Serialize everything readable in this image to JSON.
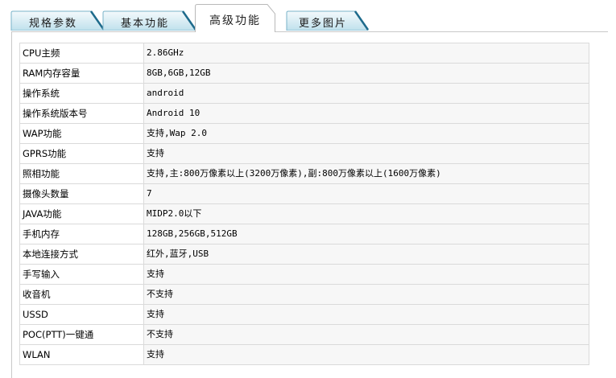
{
  "tabs": [
    {
      "label": "规格参数",
      "active": false
    },
    {
      "label": "基本功能",
      "active": false
    },
    {
      "label": "高级功能",
      "active": true
    },
    {
      "label": "更多图片",
      "active": false
    }
  ],
  "colors": {
    "tab_fill_top": "#f4fafc",
    "tab_fill_bottom": "#bfe0ec",
    "tab_border": "#7ab3c9",
    "tab_edge_dark": "#1e6b8c",
    "active_fill": "#ffffff",
    "active_border": "#b9b9b9",
    "table_border": "#dadada",
    "value_bg": "#f7f7f7"
  },
  "specs": [
    {
      "label": "CPU主频",
      "value": "2.86GHz"
    },
    {
      "label": "RAM内存容量",
      "value": "8GB,6GB,12GB"
    },
    {
      "label": "操作系统",
      "value": "android"
    },
    {
      "label": "操作系统版本号",
      "value": "Android 10"
    },
    {
      "label": "WAP功能",
      "value": "支持,Wap 2.0"
    },
    {
      "label": "GPRS功能",
      "value": "支持"
    },
    {
      "label": "照相功能",
      "value": "支持,主:800万像素以上(3200万像素),副:800万像素以上(1600万像素)"
    },
    {
      "label": "摄像头数量",
      "value": "7"
    },
    {
      "label": "JAVA功能",
      "value": "MIDP2.0以下"
    },
    {
      "label": "手机内存",
      "value": "128GB,256GB,512GB"
    },
    {
      "label": "本地连接方式",
      "value": "红外,蓝牙,USB"
    },
    {
      "label": "手写输入",
      "value": "支持"
    },
    {
      "label": "收音机",
      "value": "不支持"
    },
    {
      "label": "USSD",
      "value": "支持"
    },
    {
      "label": "POC(PTT)一键通",
      "value": "不支持"
    },
    {
      "label": "WLAN",
      "value": "支持"
    }
  ]
}
